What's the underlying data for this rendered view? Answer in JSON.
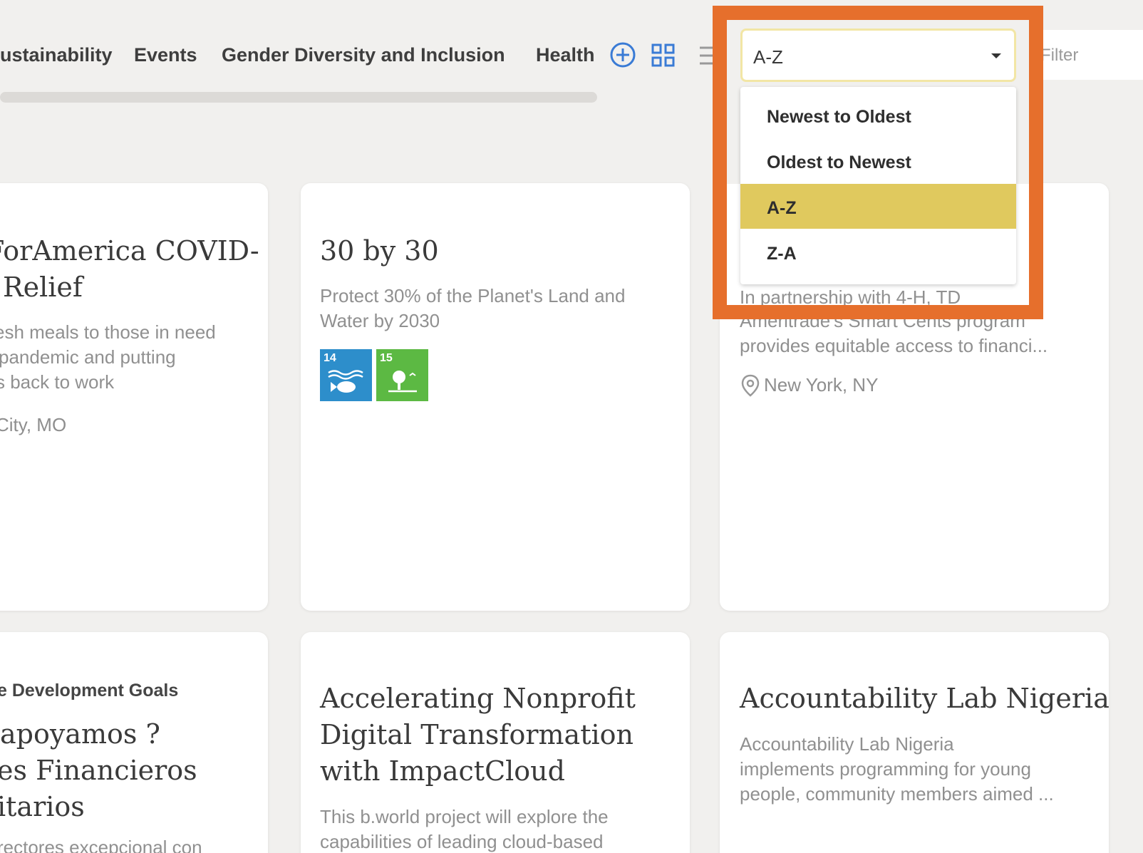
{
  "tabs": [
    {
      "label": "ustainability"
    },
    {
      "label": "Events"
    },
    {
      "label": "Gender Diversity and Inclusion"
    },
    {
      "label": "Health a"
    }
  ],
  "toolbar": {
    "add_icon": "plus-circle-icon",
    "grid_icon": "grid-view-icon",
    "list_icon": "list-view-icon",
    "filter_placeholder": "Filter"
  },
  "sort": {
    "selected": "A-Z",
    "options": [
      {
        "label": "Newest to Oldest"
      },
      {
        "label": "Oldest to Newest"
      },
      {
        "label": "A-Z"
      },
      {
        "label": "Z-A"
      }
    ]
  },
  "cards": [
    {
      "title_lines": [
        "ForAmerica COVID-",
        "Relief"
      ],
      "desc_lines": [
        "esh meals to those in need",
        "pandemic and putting",
        "s back to work"
      ],
      "location": "City, MO"
    },
    {
      "title_lines": [
        "30 by 30"
      ],
      "desc_lines": [
        "Protect 30% of the Planet's Land and",
        "Water by 2030"
      ],
      "sdgs": [
        {
          "number": "14",
          "color": "#2d8ecb"
        },
        {
          "number": "15",
          "color": "#5cb943"
        }
      ]
    },
    {
      "desc_lines": [
        "In partnership with 4-H, TD",
        "Ameritrade's Smart Cents program",
        "provides equitable access to financi..."
      ],
      "location": "New York, NY"
    },
    {
      "tag": "e Development Goals",
      "title_lines": [
        "apoyamos ?",
        "es Financieros",
        "itarios"
      ],
      "desc_lines": [
        "rectores excepcional con"
      ]
    },
    {
      "title_lines": [
        "Accelerating Nonprofit",
        "Digital Transformation",
        "with ImpactCloud"
      ],
      "desc_lines": [
        "This b.world project will explore the",
        "capabilities of leading cloud-based"
      ]
    },
    {
      "title_lines": [
        "Accountability Lab Nigeria"
      ],
      "desc_lines": [
        "Accountability Lab Nigeria",
        "implements programming for young",
        "people, community members aimed ..."
      ]
    }
  ],
  "colors": {
    "highlight": "#e66f2c",
    "selected_option": "#e0c95e",
    "background": "#f1f0ee"
  }
}
